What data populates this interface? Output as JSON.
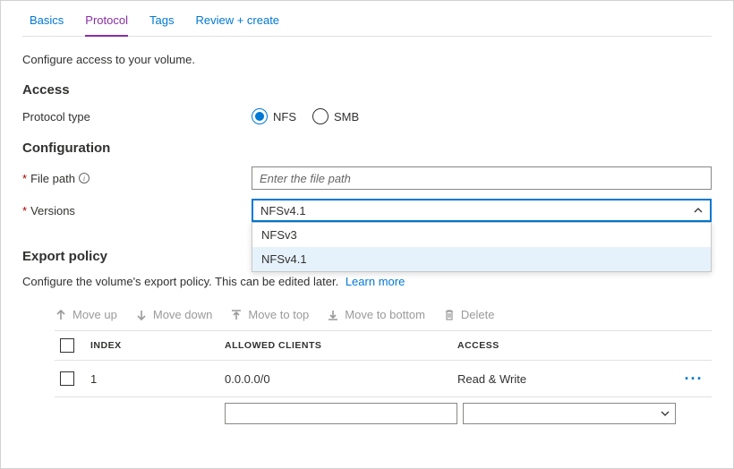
{
  "tabs": {
    "basics": "Basics",
    "protocol": "Protocol",
    "tags": "Tags",
    "review": "Review + create"
  },
  "subtitle": "Configure access to your volume.",
  "access": {
    "heading": "Access",
    "protocol_type_label": "Protocol type",
    "nfs_label": "NFS",
    "smb_label": "SMB"
  },
  "config": {
    "heading": "Configuration",
    "file_path_label": "File path",
    "file_path_placeholder": "Enter the file path",
    "versions_label": "Versions",
    "version_selected": "NFSv4.1",
    "version_options": [
      "NFSv3",
      "NFSv4.1"
    ]
  },
  "export": {
    "heading": "Export policy",
    "desc": "Configure the volume's export policy. This can be edited later.",
    "learn_more": "Learn more",
    "toolbar": {
      "move_up": "Move up",
      "move_down": "Move down",
      "move_top": "Move to top",
      "move_bottom": "Move to bottom",
      "delete": "Delete"
    },
    "columns": {
      "index": "INDEX",
      "allowed": "ALLOWED CLIENTS",
      "access": "ACCESS"
    },
    "rows": [
      {
        "index": "1",
        "allowed": "0.0.0.0/0",
        "access": "Read & Write"
      }
    ]
  }
}
